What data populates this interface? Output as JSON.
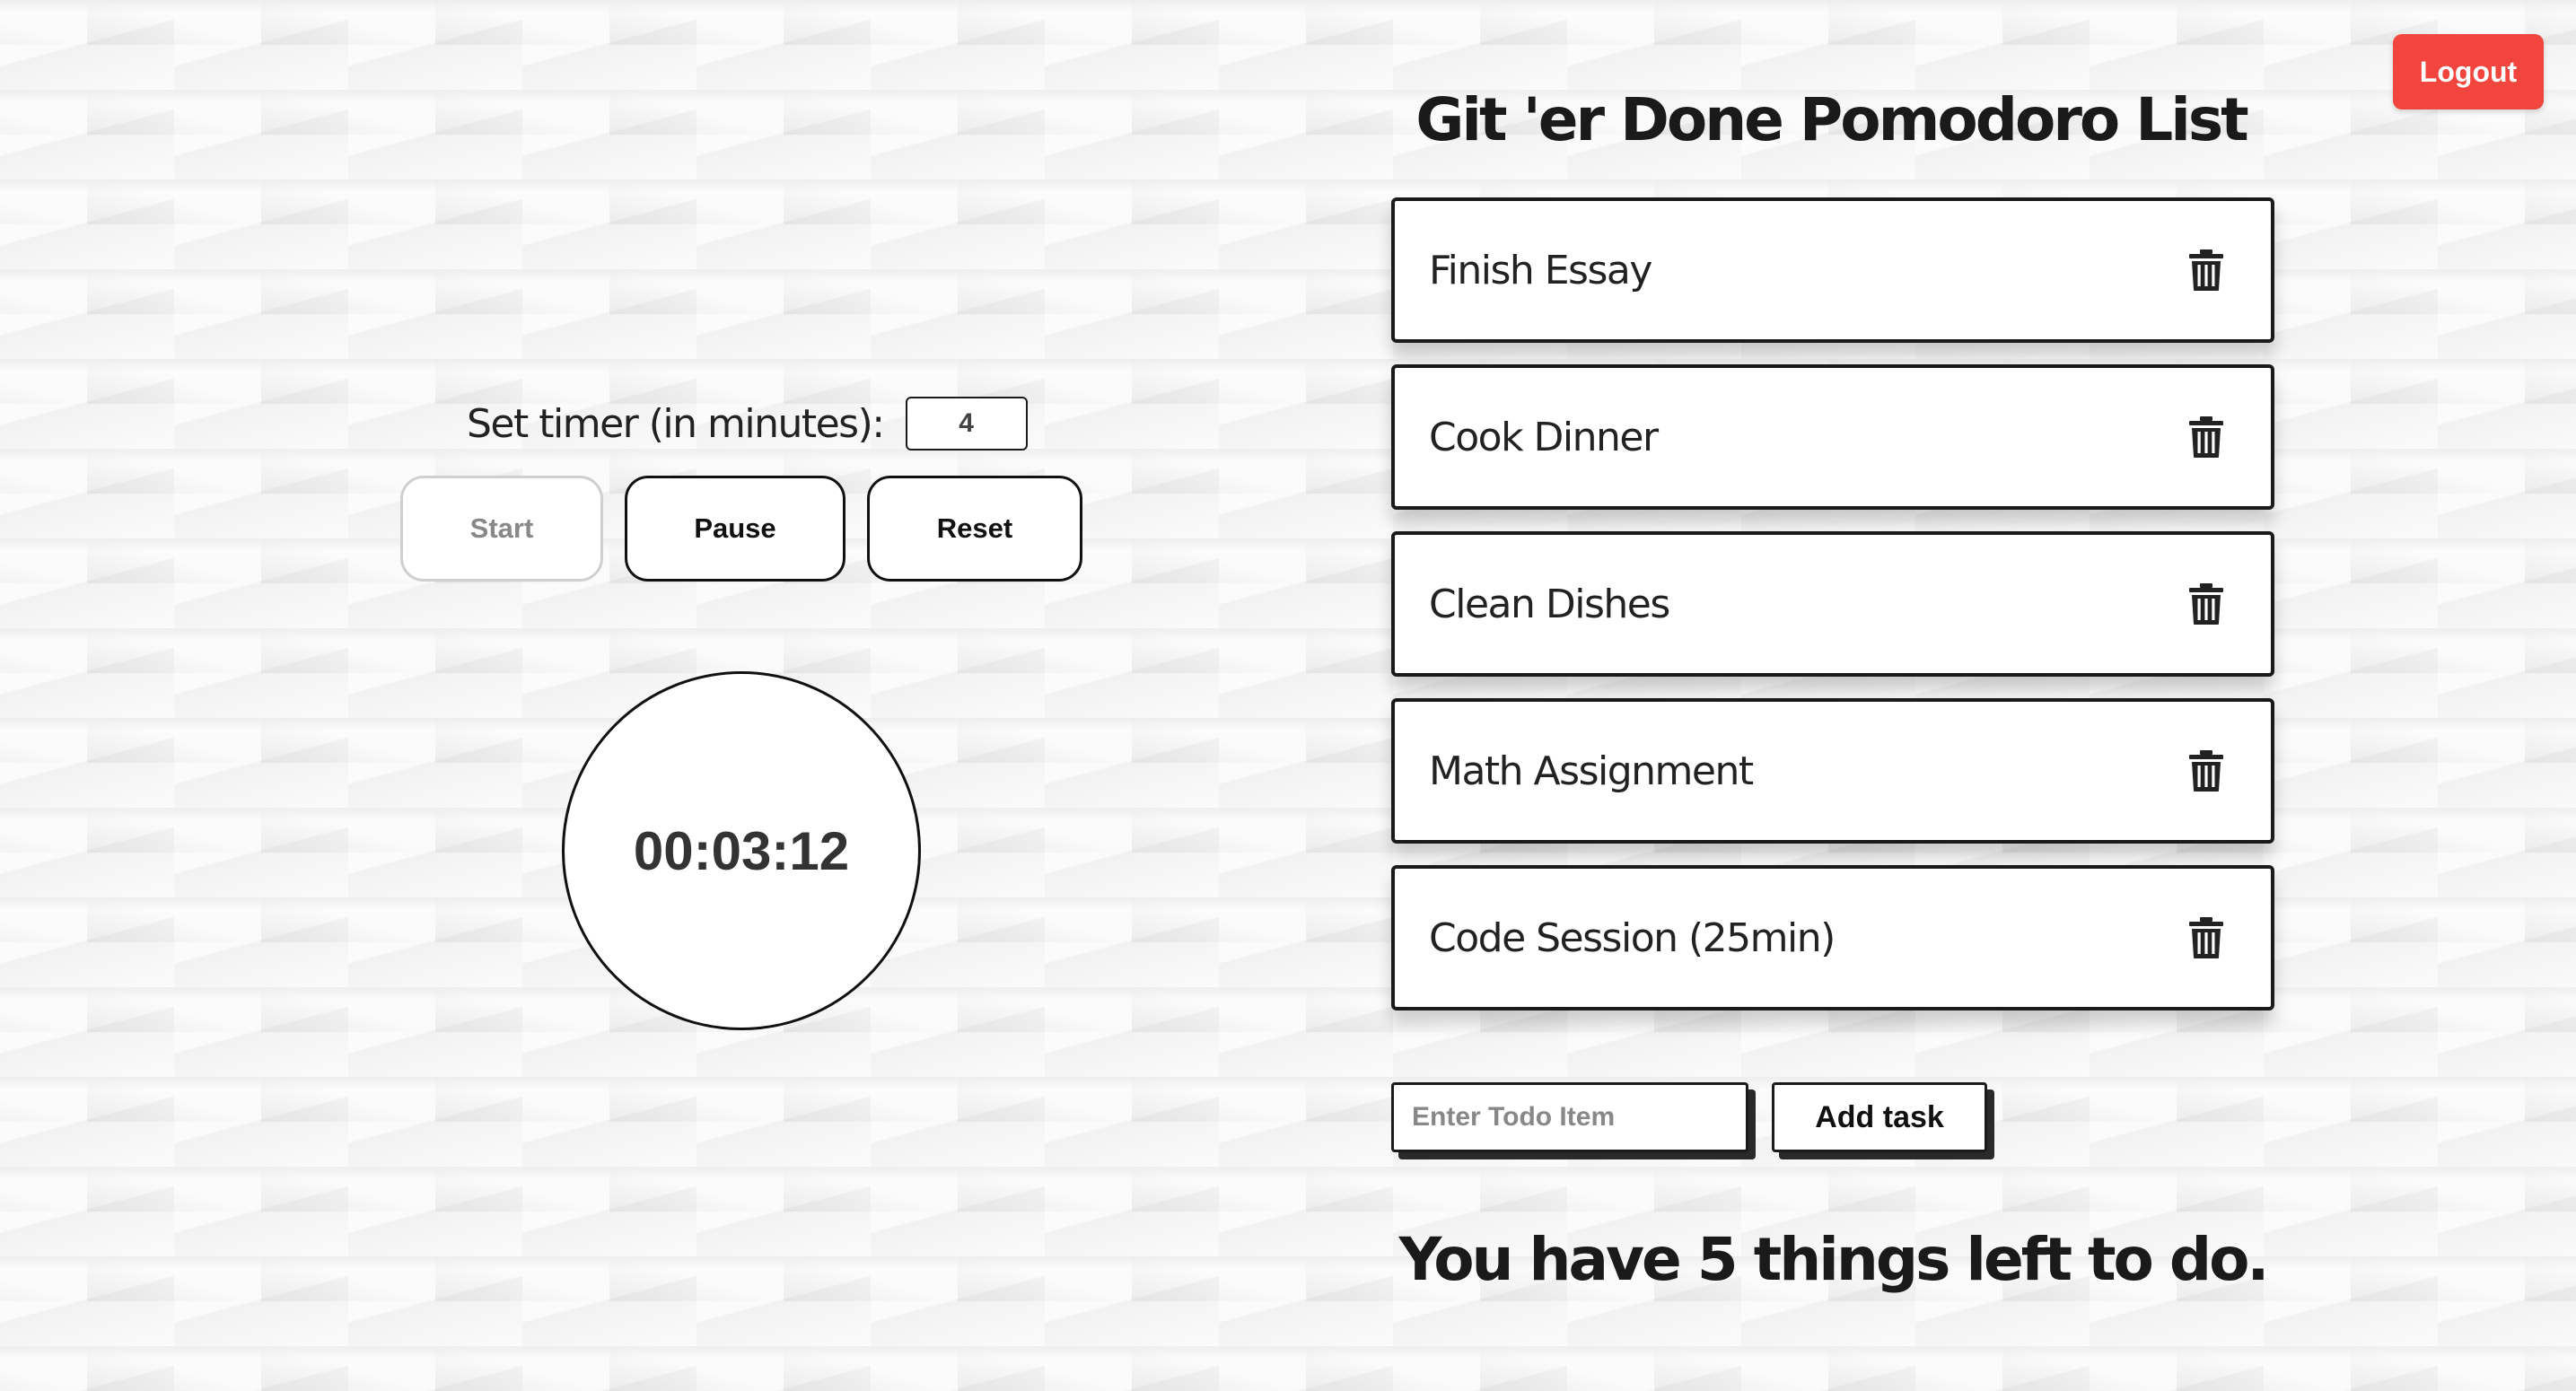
{
  "header": {
    "logout_label": "Logout"
  },
  "timer": {
    "set_label": "Set timer (in minutes):",
    "minutes_value": "4",
    "start_label": "Start",
    "pause_label": "Pause",
    "reset_label": "Reset",
    "start_disabled": true,
    "display": "00:03:12"
  },
  "todo": {
    "title": "Git 'er Done Pomodoro List",
    "items": [
      {
        "label": "Finish Essay",
        "icon": "trash-icon"
      },
      {
        "label": "Cook Dinner",
        "icon": "trash-icon"
      },
      {
        "label": "Clean Dishes",
        "icon": "trash-icon"
      },
      {
        "label": "Math Assignment",
        "icon": "trash-icon"
      },
      {
        "label": "Code Session (25min)",
        "icon": "trash-icon"
      }
    ],
    "input_placeholder": "Enter Todo Item",
    "input_value": "",
    "add_label": "Add task",
    "remaining_text": "You have 5 things left to do."
  },
  "colors": {
    "logout_bg": "#f2453d",
    "text": "#222222",
    "border": "#1a1a1a"
  }
}
